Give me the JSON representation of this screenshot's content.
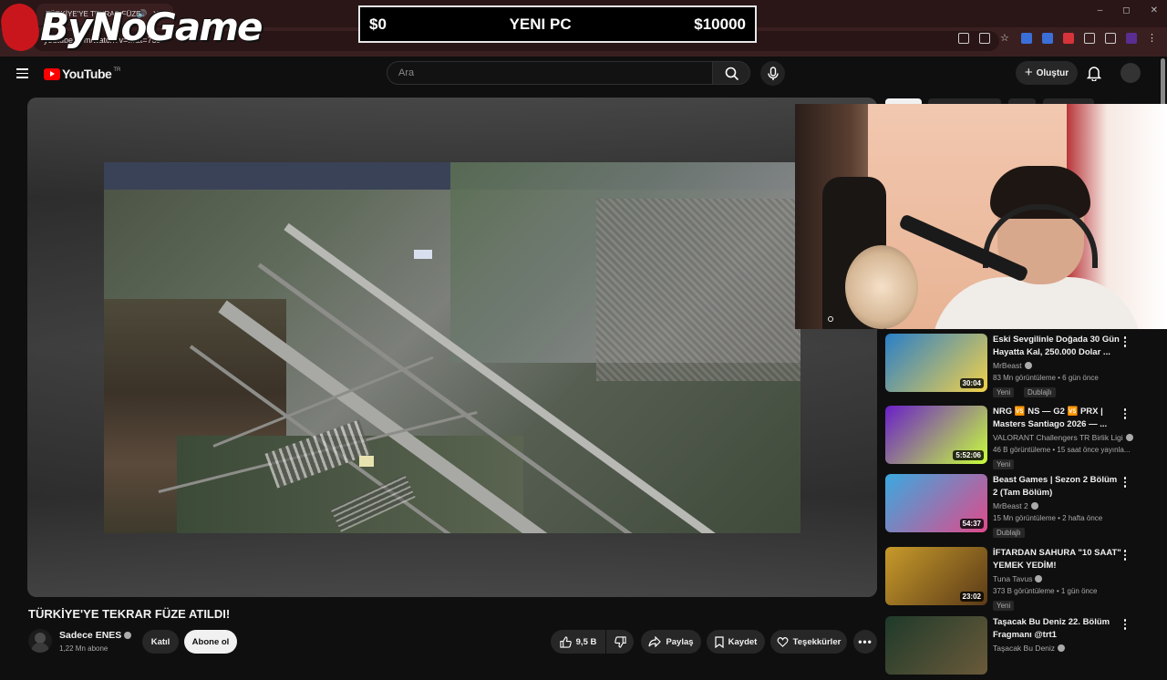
{
  "browser": {
    "tab_title": "TÜRKİYE'YE TEKRAR FÜZE",
    "url": "youtube.com/watch?v=...&t=75s",
    "window_controls": [
      "–",
      "◻",
      "✕"
    ]
  },
  "overlay": {
    "logo_text": "ByNoGame",
    "price_left": "$0",
    "price_center": "YENI PC",
    "price_right": "$10000"
  },
  "youtube": {
    "logo_text": "YouTube",
    "country_code": "TR",
    "search_placeholder": "Ara",
    "create_label": "Oluştur"
  },
  "video": {
    "title": "TÜRKİYE'YE TEKRAR FÜZE ATILDI!",
    "channel_name": "Sadece ENES",
    "subscribers": "1,22 Mn abone",
    "join_label": "Katıl",
    "subscribe_label": "Abone ol",
    "likes": "9,5 B",
    "share_label": "Paylaş",
    "save_label": "Kaydet",
    "thanks_label": "Teşekkürler"
  },
  "recommendations": [
    {
      "title": "Eski Sevgilinle Doğada 30 Gün Hayatta Kal, 250.000 Dolar ...",
      "channel": "MrBeast",
      "meta": "83 Mn görüntüleme • 6 gün önce",
      "badges": [
        "Yeni",
        "Dublajlı"
      ],
      "duration": "30:04",
      "thumb_colors": [
        "#2a7fc8",
        "#f2d14a"
      ]
    },
    {
      "title": "NRG 🆚 NS — G2 🆚 PRX | Masters Santiago 2026 — ...",
      "channel": "VALORANT Challengers TR Birlik Ligi",
      "meta": "46 B görüntüleme • 15 saat önce yayınla...",
      "badges": [
        "Yeni"
      ],
      "duration": "5:52:06",
      "thumb_colors": [
        "#6a1fc9",
        "#c8ff3a"
      ]
    },
    {
      "title": "Beast Games | Sezon 2 Bölüm 2 (Tam Bölüm)",
      "channel": "MrBeast 2",
      "meta": "15 Mn görüntüleme • 2 hafta önce",
      "badges": [
        "Dublajlı"
      ],
      "duration": "54:37",
      "thumb_colors": [
        "#3aa9e0",
        "#e04a8a"
      ]
    },
    {
      "title": "İFTARDAN SAHURA \"10 SAAT\" YEMEK YEDİM!",
      "channel": "Tuna Tavus",
      "meta": "373 B görüntüleme • 1 gün önce",
      "badges": [
        "Yeni"
      ],
      "duration": "23:02",
      "thumb_colors": [
        "#c89a2a",
        "#5a3a18"
      ]
    },
    {
      "title": "Taşacak Bu Deniz 22. Bölüm Fragmanı @trt1",
      "channel": "Taşacak Bu Deniz",
      "meta": "",
      "badges": [],
      "duration": "",
      "thumb_colors": [
        "#1f3a2a",
        "#6a5a3a"
      ]
    }
  ]
}
